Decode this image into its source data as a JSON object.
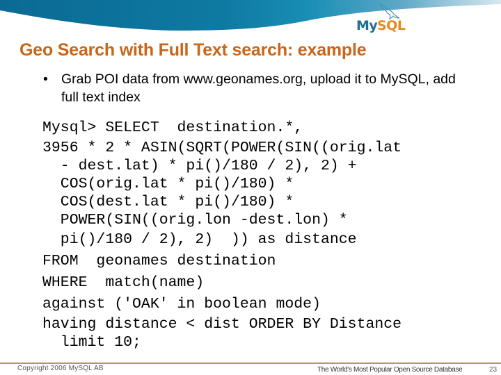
{
  "slide": {
    "title": "Geo Search with Full Text search: example",
    "bullets": [
      {
        "marker": "•",
        "text": "Grab POI data from www.geonames.org, upload it to MySQL, add full text index"
      }
    ],
    "code_lines": [
      "Mysql> SELECT  destination.*,",
      "3956 * 2 * ASIN(SQRT(POWER(SIN((orig.lat",
      "  - dest.lat) * pi()/180 / 2), 2) +",
      "  COS(orig.lat * pi()/180) *",
      "  COS(dest.lat * pi()/180) *",
      "  POWER(SIN((orig.lon -dest.lon) *",
      "  pi()/180 / 2), 2)  )) as distance",
      "FROM  geonames destination",
      "WHERE  match(name)",
      "against ('OAK' in boolean mode)",
      "having distance < dist ORDER BY Distance",
      "  limit 10;"
    ]
  },
  "logo": {
    "my": "My",
    "sql": "SQL",
    "icon": "dolphin-icon",
    "colors": {
      "my": "#1f6f91",
      "sql": "#e48a1e"
    }
  },
  "footer": {
    "copyright": "Copyright 2006 MySQL AB",
    "tagline": "The World's Most Popular Open Source Database",
    "page_number": "23"
  },
  "colors": {
    "title": "#c8661a",
    "header_wave": "#0f6f98",
    "footer_rule": "#b09a5a"
  }
}
